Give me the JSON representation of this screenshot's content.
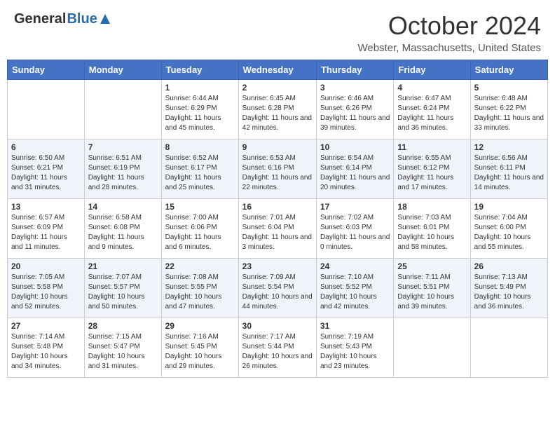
{
  "header": {
    "logo_general": "General",
    "logo_blue": "Blue",
    "month_title": "October 2024",
    "location": "Webster, Massachusetts, United States"
  },
  "days_of_week": [
    "Sunday",
    "Monday",
    "Tuesday",
    "Wednesday",
    "Thursday",
    "Friday",
    "Saturday"
  ],
  "weeks": [
    [
      {
        "day": "",
        "info": ""
      },
      {
        "day": "",
        "info": ""
      },
      {
        "day": "1",
        "info": "Sunrise: 6:44 AM\nSunset: 6:29 PM\nDaylight: 11 hours and 45 minutes."
      },
      {
        "day": "2",
        "info": "Sunrise: 6:45 AM\nSunset: 6:28 PM\nDaylight: 11 hours and 42 minutes."
      },
      {
        "day": "3",
        "info": "Sunrise: 6:46 AM\nSunset: 6:26 PM\nDaylight: 11 hours and 39 minutes."
      },
      {
        "day": "4",
        "info": "Sunrise: 6:47 AM\nSunset: 6:24 PM\nDaylight: 11 hours and 36 minutes."
      },
      {
        "day": "5",
        "info": "Sunrise: 6:48 AM\nSunset: 6:22 PM\nDaylight: 11 hours and 33 minutes."
      }
    ],
    [
      {
        "day": "6",
        "info": "Sunrise: 6:50 AM\nSunset: 6:21 PM\nDaylight: 11 hours and 31 minutes."
      },
      {
        "day": "7",
        "info": "Sunrise: 6:51 AM\nSunset: 6:19 PM\nDaylight: 11 hours and 28 minutes."
      },
      {
        "day": "8",
        "info": "Sunrise: 6:52 AM\nSunset: 6:17 PM\nDaylight: 11 hours and 25 minutes."
      },
      {
        "day": "9",
        "info": "Sunrise: 6:53 AM\nSunset: 6:16 PM\nDaylight: 11 hours and 22 minutes."
      },
      {
        "day": "10",
        "info": "Sunrise: 6:54 AM\nSunset: 6:14 PM\nDaylight: 11 hours and 20 minutes."
      },
      {
        "day": "11",
        "info": "Sunrise: 6:55 AM\nSunset: 6:12 PM\nDaylight: 11 hours and 17 minutes."
      },
      {
        "day": "12",
        "info": "Sunrise: 6:56 AM\nSunset: 6:11 PM\nDaylight: 11 hours and 14 minutes."
      }
    ],
    [
      {
        "day": "13",
        "info": "Sunrise: 6:57 AM\nSunset: 6:09 PM\nDaylight: 11 hours and 11 minutes."
      },
      {
        "day": "14",
        "info": "Sunrise: 6:58 AM\nSunset: 6:08 PM\nDaylight: 11 hours and 9 minutes."
      },
      {
        "day": "15",
        "info": "Sunrise: 7:00 AM\nSunset: 6:06 PM\nDaylight: 11 hours and 6 minutes."
      },
      {
        "day": "16",
        "info": "Sunrise: 7:01 AM\nSunset: 6:04 PM\nDaylight: 11 hours and 3 minutes."
      },
      {
        "day": "17",
        "info": "Sunrise: 7:02 AM\nSunset: 6:03 PM\nDaylight: 11 hours and 0 minutes."
      },
      {
        "day": "18",
        "info": "Sunrise: 7:03 AM\nSunset: 6:01 PM\nDaylight: 10 hours and 58 minutes."
      },
      {
        "day": "19",
        "info": "Sunrise: 7:04 AM\nSunset: 6:00 PM\nDaylight: 10 hours and 55 minutes."
      }
    ],
    [
      {
        "day": "20",
        "info": "Sunrise: 7:05 AM\nSunset: 5:58 PM\nDaylight: 10 hours and 52 minutes."
      },
      {
        "day": "21",
        "info": "Sunrise: 7:07 AM\nSunset: 5:57 PM\nDaylight: 10 hours and 50 minutes."
      },
      {
        "day": "22",
        "info": "Sunrise: 7:08 AM\nSunset: 5:55 PM\nDaylight: 10 hours and 47 minutes."
      },
      {
        "day": "23",
        "info": "Sunrise: 7:09 AM\nSunset: 5:54 PM\nDaylight: 10 hours and 44 minutes."
      },
      {
        "day": "24",
        "info": "Sunrise: 7:10 AM\nSunset: 5:52 PM\nDaylight: 10 hours and 42 minutes."
      },
      {
        "day": "25",
        "info": "Sunrise: 7:11 AM\nSunset: 5:51 PM\nDaylight: 10 hours and 39 minutes."
      },
      {
        "day": "26",
        "info": "Sunrise: 7:13 AM\nSunset: 5:49 PM\nDaylight: 10 hours and 36 minutes."
      }
    ],
    [
      {
        "day": "27",
        "info": "Sunrise: 7:14 AM\nSunset: 5:48 PM\nDaylight: 10 hours and 34 minutes."
      },
      {
        "day": "28",
        "info": "Sunrise: 7:15 AM\nSunset: 5:47 PM\nDaylight: 10 hours and 31 minutes."
      },
      {
        "day": "29",
        "info": "Sunrise: 7:16 AM\nSunset: 5:45 PM\nDaylight: 10 hours and 29 minutes."
      },
      {
        "day": "30",
        "info": "Sunrise: 7:17 AM\nSunset: 5:44 PM\nDaylight: 10 hours and 26 minutes."
      },
      {
        "day": "31",
        "info": "Sunrise: 7:19 AM\nSunset: 5:43 PM\nDaylight: 10 hours and 23 minutes."
      },
      {
        "day": "",
        "info": ""
      },
      {
        "day": "",
        "info": ""
      }
    ]
  ]
}
